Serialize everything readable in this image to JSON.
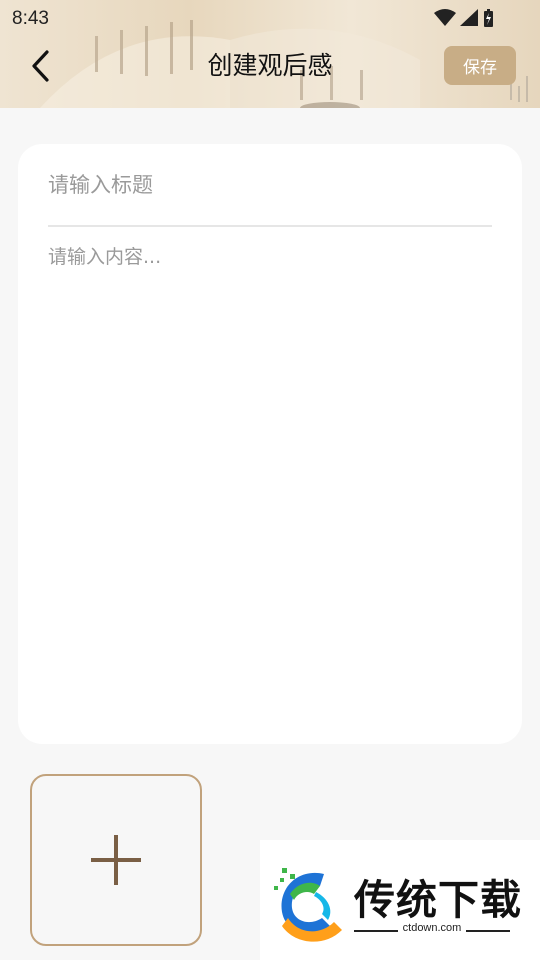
{
  "status_bar": {
    "time": "8:43"
  },
  "header": {
    "title": "创建观后感",
    "save_label": "保存"
  },
  "editor": {
    "title_placeholder": "请输入标题",
    "content_placeholder": "请输入内容..."
  },
  "icons": {
    "back": "chevron-left-icon",
    "add": "plus-icon",
    "wifi": "wifi-icon",
    "signal": "signal-icon",
    "battery": "battery-charging-icon"
  },
  "colors": {
    "accent": "#c8ad86",
    "add_border": "#c1a27c",
    "plus": "#7a5f45",
    "background": "#f7f7f7"
  },
  "watermark": {
    "text": "传统下载",
    "domain": "ctdown.com"
  }
}
